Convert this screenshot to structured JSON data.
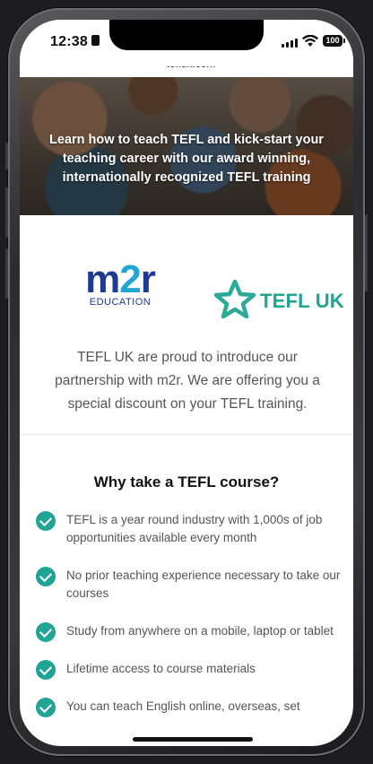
{
  "status_bar": {
    "time": "12:38",
    "battery": "100"
  },
  "browser": {
    "url": "tefluk.com"
  },
  "hero": {
    "text": "Learn how to teach TEFL and kick-start your teaching career with our award winning, internationally recognized TEFL training"
  },
  "logos": {
    "m2r": {
      "main_prefix": "m",
      "main_digit": "2",
      "main_suffix": "r",
      "subtitle": "EDUCATION"
    },
    "tefl": {
      "text": "TEFL UK"
    }
  },
  "intro": "TEFL UK are proud to introduce our partnership with m2r. We are offering you a special discount on your TEFL training.",
  "why": {
    "title": "Why take a TEFL course?",
    "items": [
      "TEFL is a year round industry with 1,000s of job opportunities available every month",
      "No prior teaching experience necessary to take our courses",
      "Study from anywhere on a mobile, laptop or tablet",
      "Lifetime access to course materials",
      "You can teach English online, overseas, set"
    ]
  },
  "colors": {
    "accent": "#20a494",
    "m2r_blue": "#1f3a93",
    "m2r_light_blue": "#21a5d6"
  }
}
